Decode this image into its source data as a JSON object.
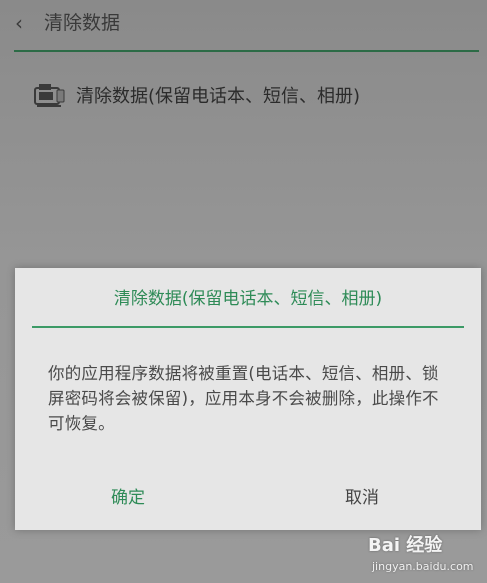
{
  "header": {
    "back_icon": "chevron-left-icon",
    "title": "清除数据"
  },
  "option": {
    "icon": "phone-storage-icon",
    "label": "清除数据(保留电话本、短信、相册)"
  },
  "dialog": {
    "title": "清除数据(保留电话本、短信、相册)",
    "message": "你的应用程序数据将被重置(电话本、短信、相册、锁屏密码将会被保留)，应用本身不会被删除，此操作不可恢复。",
    "confirm_label": "确定",
    "cancel_label": "取消",
    "accent_color": "#2e8b57"
  },
  "watermark": {
    "brand": "Bai 经验",
    "url": "jingyan.baidu.com"
  }
}
